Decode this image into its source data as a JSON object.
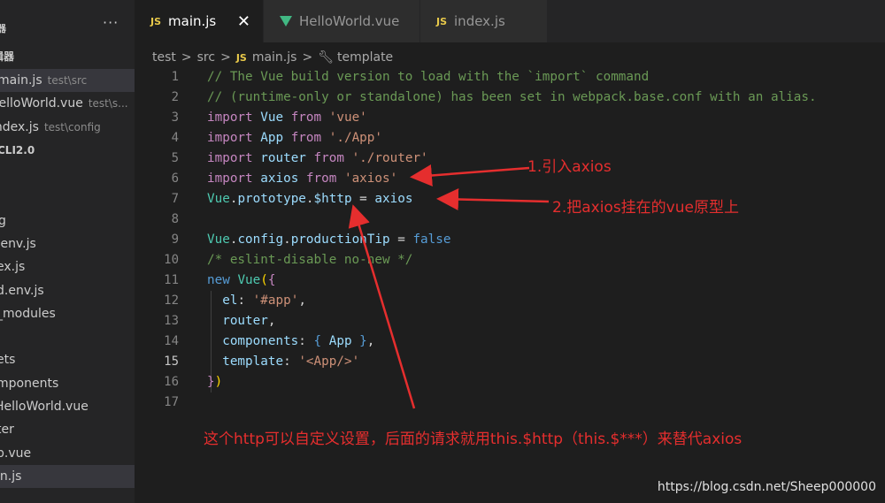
{
  "sidebar": {
    "more_label": "···",
    "header_fragment": "器",
    "header2_fragment": "辑器",
    "open_editors": [
      {
        "name": "main.js",
        "path": "test\\src"
      },
      {
        "name": "HelloWorld.vue",
        "path": "test\\s..."
      },
      {
        "name": "index.js",
        "path": "test\\config"
      }
    ],
    "project_label": "CLI2.0",
    "tree": [
      "g",
      ".env.js",
      "ex.js",
      "d.env.js",
      "_modules",
      "ets",
      "mponents",
      "HelloWorld.vue",
      "ter",
      "p.vue",
      "in.js"
    ]
  },
  "tabs": [
    {
      "label": "main.js",
      "icon": "js-icon",
      "active": true
    },
    {
      "label": "HelloWorld.vue",
      "icon": "vue-icon",
      "active": false
    },
    {
      "label": "index.js",
      "icon": "js-icon",
      "active": false
    }
  ],
  "tab_close": "✕",
  "breadcrumb": {
    "items": [
      "test",
      "src",
      "main.js",
      "template"
    ],
    "separator": ">"
  },
  "code": {
    "line_numbers": [
      "1",
      "2",
      "3",
      "4",
      "5",
      "6",
      "7",
      "8",
      "9",
      "10",
      "11",
      "12",
      "13",
      "14",
      "15",
      "16",
      "17"
    ],
    "current_line": "15"
  },
  "annotations": {
    "one": "1.引入axios",
    "two": "2.把axios挂在的vue原型上",
    "three": "这个http可以自定义设置，后面的请求就用this.$http（this.$***）来替代axios"
  },
  "watermark": "https://blog.csdn.net/Sheep000000",
  "colors": {
    "annotation": "#e52e2e",
    "editor_bg": "#1e1e1e",
    "sidebar_bg": "#252526"
  }
}
